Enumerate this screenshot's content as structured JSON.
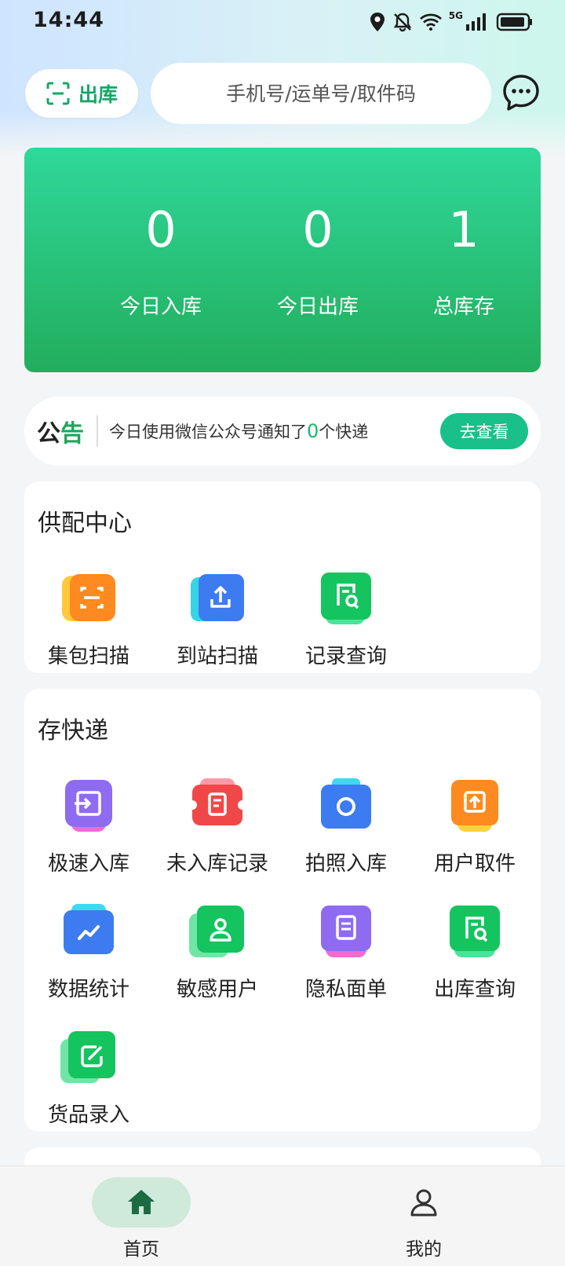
{
  "status_bar": {
    "time": "14:44",
    "network": "5G",
    "icons": [
      "location-icon",
      "bell-off-icon",
      "wifi-icon",
      "signal-icon",
      "battery-icon"
    ]
  },
  "header": {
    "outbound_label": "出库",
    "search_placeholder": "手机号/运单号/取件码",
    "message_icon": "chat-bubble-icon"
  },
  "stats": [
    {
      "value": "0",
      "label": "今日入库"
    },
    {
      "value": "0",
      "label": "今日出库"
    },
    {
      "value": "1",
      "label": "总库存"
    }
  ],
  "notice": {
    "title_part1": "公",
    "title_part2": "告",
    "text_before": "今日使用微信公众号通知了",
    "count": "0",
    "text_after": "个快递",
    "button": "去查看"
  },
  "supply_center": {
    "title": "供配中心",
    "items": [
      {
        "label": "集包扫描",
        "icon": "scan-icon"
      },
      {
        "label": "到站扫描",
        "icon": "upload-icon"
      },
      {
        "label": "记录查询",
        "icon": "doc-search-icon"
      }
    ]
  },
  "store_express": {
    "title": "存快递",
    "items": [
      {
        "label": "极速入库",
        "icon": "import-icon"
      },
      {
        "label": "未入库记录",
        "icon": "ticket-icon"
      },
      {
        "label": "拍照入库",
        "icon": "camera-icon"
      },
      {
        "label": "用户取件",
        "icon": "pickup-icon"
      },
      {
        "label": "数据统计",
        "icon": "chart-icon"
      },
      {
        "label": "敏感用户",
        "icon": "user-icon"
      },
      {
        "label": "隐私面单",
        "icon": "privacy-doc-icon"
      },
      {
        "label": "出库查询",
        "icon": "outbound-search-icon"
      },
      {
        "label": "货品录入",
        "icon": "edit-icon"
      }
    ]
  },
  "colors": {
    "brand_green": "#1ca75b",
    "stats_top": "#2fd89a",
    "stats_bottom": "#22ad5c",
    "accent_teal": "#19c08a"
  },
  "bottom_nav": [
    {
      "label": "首页",
      "icon": "home-icon",
      "active": true
    },
    {
      "label": "我的",
      "icon": "person-icon",
      "active": false
    }
  ]
}
